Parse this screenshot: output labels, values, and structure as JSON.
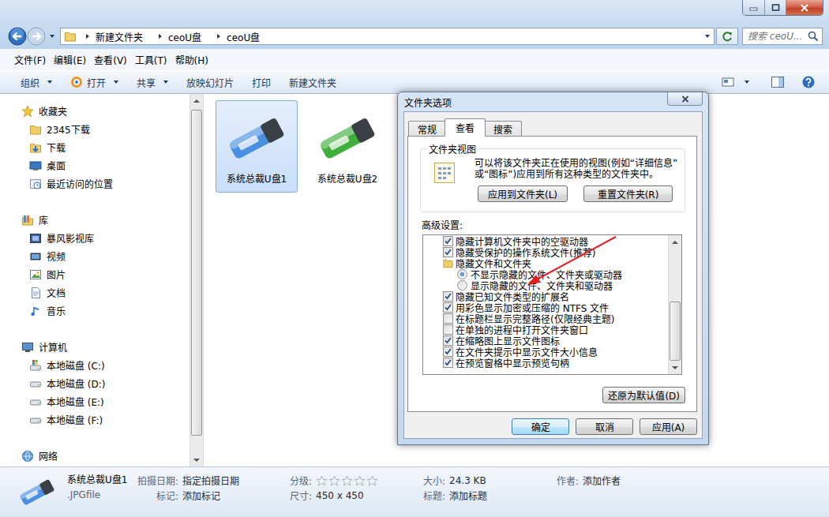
{
  "address": {
    "crumbs": [
      "新建文件夹",
      "ceoU盘",
      "ceoU盘"
    ]
  },
  "search": {
    "placeholder": "搜索 ceoU..."
  },
  "menu": [
    "文件(F)",
    "编辑(E)",
    "查看(V)",
    "工具(T)",
    "帮助(H)"
  ],
  "toolbar": [
    {
      "label": "组织",
      "kind": "menu"
    },
    {
      "label": "打开",
      "kind": "menu"
    },
    {
      "label": "共享",
      "kind": "menu"
    },
    {
      "label": "放映幻灯片",
      "kind": "button"
    },
    {
      "label": "打印",
      "kind": "button"
    },
    {
      "label": "新建文件夹",
      "kind": "button"
    }
  ],
  "sidebar": {
    "groups": [
      {
        "label": "收藏夹",
        "items": [
          "2345下载",
          "下载",
          "桌面",
          "最近访问的位置"
        ]
      },
      {
        "label": "库",
        "items": [
          "暴风影视库",
          "视频",
          "图片",
          "文档",
          "音乐"
        ]
      },
      {
        "label": "计算机",
        "items": [
          "本地磁盘 (C:)",
          "本地磁盘 (D:)",
          "本地磁盘 (E:)",
          "本地磁盘 (F:)"
        ]
      },
      {
        "label": "网络",
        "items": []
      }
    ]
  },
  "files": [
    {
      "name": "系统总裁U盘1",
      "selected": true,
      "color": "#4a8fe0"
    },
    {
      "name": "系统总裁U盘2",
      "selected": false,
      "color": "#3fae3a"
    }
  ],
  "status_bar": {
    "name": "系统总裁U盘1",
    "type": ".JPGfile",
    "columns": [
      [
        {
          "label": "拍摄日期:",
          "kind": "text",
          "value": "指定拍摄日期"
        },
        {
          "label": "标记:",
          "kind": "text",
          "value": "添加标记"
        }
      ],
      [
        {
          "label": "分级:",
          "kind": "stars",
          "stars": 0
        },
        {
          "label": "尺寸:",
          "kind": "text",
          "value": "450 x 450"
        }
      ],
      [
        {
          "label": "大小:",
          "kind": "text",
          "value": "24.3 KB"
        },
        {
          "label": "标题:",
          "kind": "text",
          "value": "添加标题"
        }
      ],
      [
        {
          "label": "作者:",
          "kind": "text",
          "value": "添加作者"
        }
      ]
    ]
  },
  "dialog": {
    "title": "文件夹选项",
    "tabs": [
      {
        "label": "常规",
        "selected": false
      },
      {
        "label": "查看",
        "selected": true
      },
      {
        "label": "搜索",
        "selected": false
      }
    ],
    "folder_views": {
      "legend": "文件夹视图",
      "text": "可以将该文件夹正在使用的视图(例如“详细信息”或“图标”)应用到所有这种类型的文件夹中。",
      "buttons": [
        "应用到文件夹(L)",
        "重置文件夹(R)"
      ]
    },
    "advanced": {
      "label": "高级设置:",
      "items": [
        {
          "kind": "checkbox",
          "label": "隐藏计算机文件夹中的空驱动器",
          "checked": true
        },
        {
          "kind": "checkbox",
          "label": "隐藏受保护的操作系统文件(推荐)",
          "checked": true
        },
        {
          "kind": "folder",
          "label": "隐藏文件和文件夹"
        },
        {
          "kind": "radio",
          "label": "不显示隐藏的文件、文件夹或驱动器",
          "selected": true
        },
        {
          "kind": "radio",
          "label": "显示隐藏的文件、文件夹和驱动器",
          "selected": false
        },
        {
          "kind": "checkbox",
          "label": "隐藏已知文件类型的扩展名",
          "checked": true
        },
        {
          "kind": "checkbox",
          "label": "用彩色显示加密或压缩的 NTFS 文件",
          "checked": true
        },
        {
          "kind": "checkbox",
          "label": "在标题栏显示完整路径(仅限经典主题)",
          "checked": false
        },
        {
          "kind": "checkbox",
          "label": "在单独的进程中打开文件夹窗口",
          "checked": false
        },
        {
          "kind": "checkbox",
          "label": "在缩略图上显示文件图标",
          "checked": true
        },
        {
          "kind": "checkbox",
          "label": "在文件夹提示中显示文件大小信息",
          "checked": true
        },
        {
          "kind": "checkbox",
          "label": "在预览窗格中显示预览句柄",
          "checked": true
        }
      ]
    },
    "restore_button": "还原为默认值(D)",
    "buttons": [
      "确定",
      "取消",
      "应用(A)"
    ]
  }
}
